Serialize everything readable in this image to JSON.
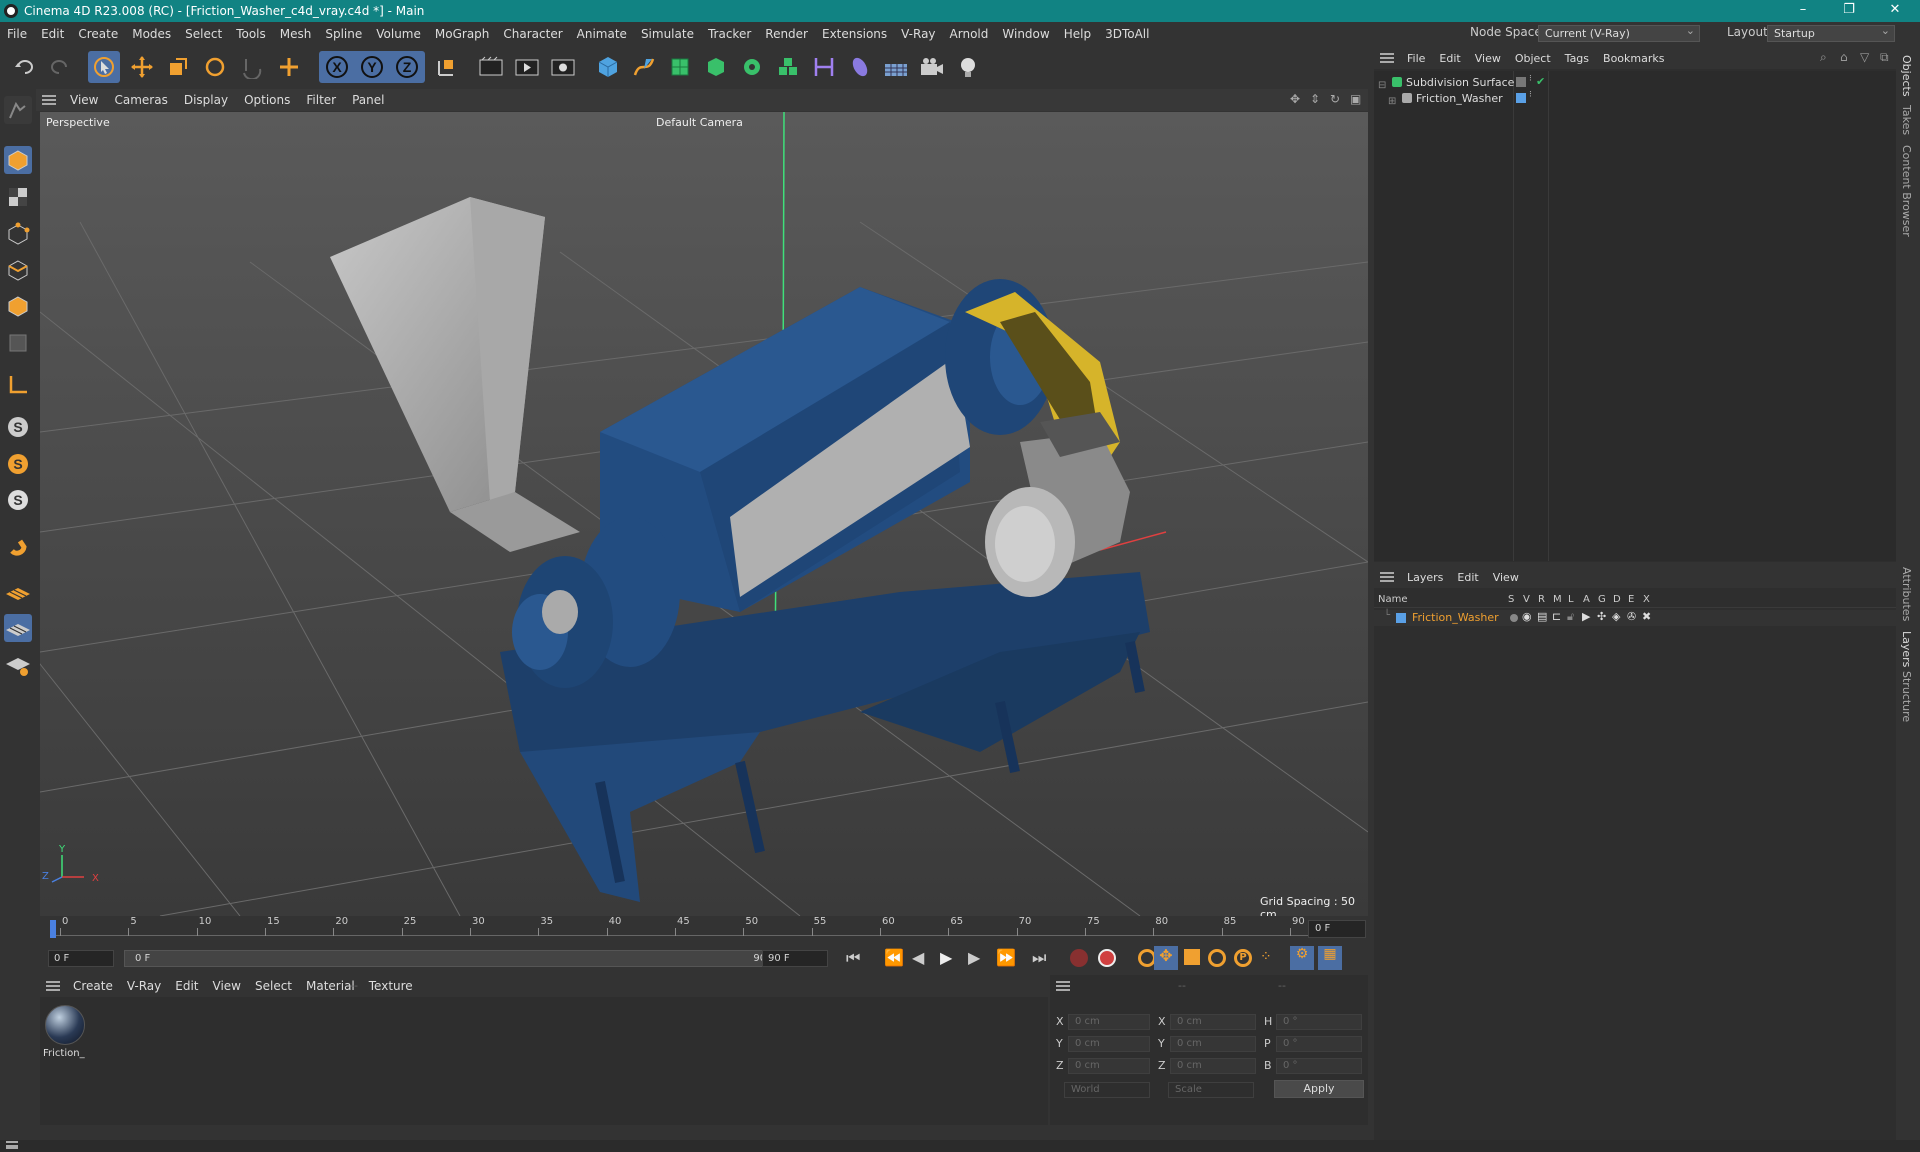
{
  "window": {
    "title": "Cinema 4D R23.008 (RC) - [Friction_Washer_c4d_vray.c4d *] - Main"
  },
  "menu": [
    "File",
    "Edit",
    "Create",
    "Modes",
    "Select",
    "Tools",
    "Mesh",
    "Spline",
    "Volume",
    "MoGraph",
    "Character",
    "Animate",
    "Simulate",
    "Tracker",
    "Render",
    "Extensions",
    "V-Ray",
    "Arnold",
    "Window",
    "Help",
    "3DToAll"
  ],
  "node_space": {
    "label": "Node Space:",
    "value": "Current (V-Ray)"
  },
  "layout": {
    "label": "Layout:",
    "value": "Startup"
  },
  "viewport": {
    "menu": [
      "View",
      "Cameras",
      "Display",
      "Options",
      "Filter",
      "Panel"
    ],
    "name": "Perspective",
    "camera": "Default Camera",
    "grid_spacing": "Grid Spacing : 50 cm",
    "axis": {
      "x": "X",
      "y": "Y",
      "z": "Z"
    }
  },
  "timeline": {
    "ticks": [
      "0",
      "5",
      "10",
      "15",
      "20",
      "25",
      "30",
      "35",
      "40",
      "45",
      "50",
      "55",
      "60",
      "65",
      "70",
      "75",
      "80",
      "85",
      "90"
    ],
    "frame_field": "0 F"
  },
  "playbar": {
    "start": "0 F",
    "range_start": "0 F",
    "range_end": "90 F",
    "end": "90 F"
  },
  "material_manager": {
    "menu": [
      "Create",
      "V-Ray",
      "Edit",
      "View",
      "Select",
      "Material",
      "Texture"
    ],
    "materials": [
      {
        "name": "Friction_"
      }
    ]
  },
  "coordinates": {
    "headers": [
      "--",
      "--",
      "--"
    ],
    "rows": [
      {
        "l1": "X",
        "v1": "0 cm",
        "l2": "X",
        "v2": "0 cm",
        "l3": "H",
        "v3": "0 °"
      },
      {
        "l1": "Y",
        "v1": "0 cm",
        "l2": "Y",
        "v2": "0 cm",
        "l3": "P",
        "v3": "0 °"
      },
      {
        "l1": "Z",
        "v1": "0 cm",
        "l2": "Z",
        "v2": "0 cm",
        "l3": "B",
        "v3": "0 °"
      }
    ],
    "space": "World",
    "mode": "Scale",
    "apply": "Apply"
  },
  "objects_panel": {
    "menu": [
      "File",
      "Edit",
      "View",
      "Object",
      "Tags",
      "Bookmarks"
    ],
    "items": [
      {
        "name": "Subdivision Surface"
      },
      {
        "name": "Friction_Washer"
      }
    ]
  },
  "layers_panel": {
    "menu": [
      "Layers",
      "Edit",
      "View"
    ],
    "columns": [
      "Name",
      "S",
      "V",
      "R",
      "M",
      "L",
      "A",
      "G",
      "D",
      "E",
      "X"
    ],
    "rows": [
      {
        "name": "Friction_Washer",
        "color": "#5aa0e6"
      }
    ]
  },
  "side_tabs": [
    "Objects",
    "Takes",
    "Content Browser",
    "Attributes",
    "Layers",
    "Structure"
  ],
  "colors": {
    "titlebar": "#118383",
    "accent_orange": "#f0a030",
    "selected_blue": "#4b6ea3"
  }
}
